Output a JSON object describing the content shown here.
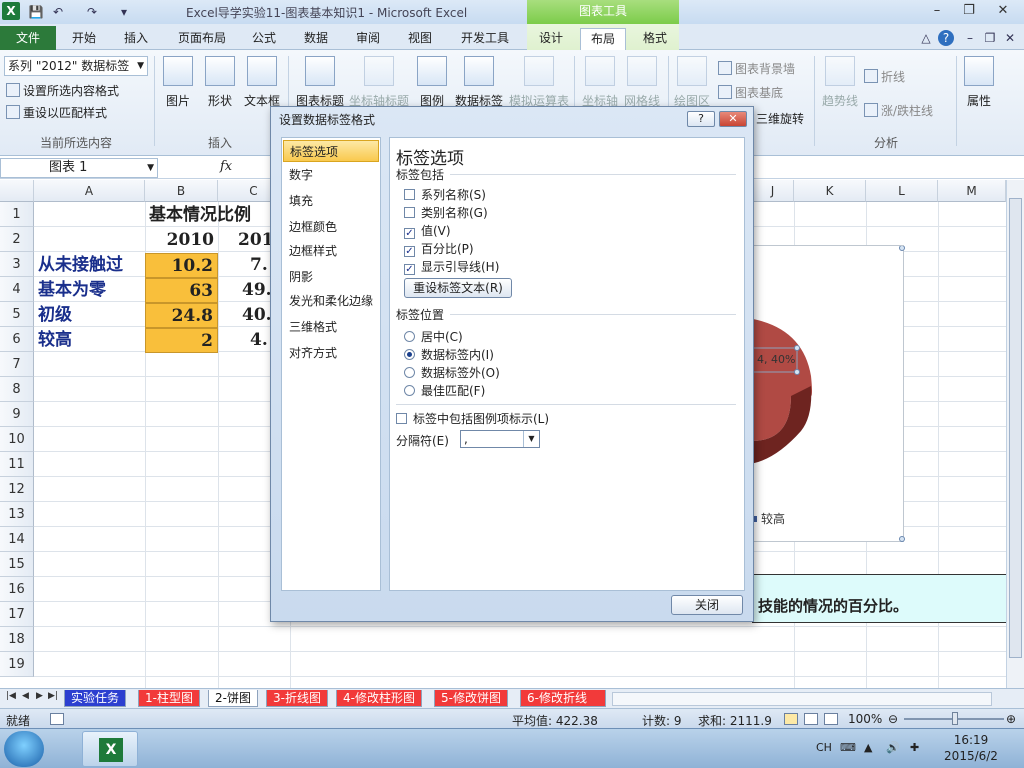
{
  "window": {
    "title": "Excel导学实验11-图表基本知识1 - Microsoft Excel",
    "chart_tools": "图表工具",
    "min": "–",
    "max": "❐",
    "close": "✕"
  },
  "qat": {
    "save": "💾",
    "undo": "↶",
    "redo": "↷",
    "customize": "▾"
  },
  "tabs": [
    "文件",
    "开始",
    "插入",
    "页面布局",
    "公式",
    "数据",
    "审阅",
    "视图",
    "开发工具",
    "设计",
    "布局",
    "格式"
  ],
  "tab_right": {
    "collapse": "△",
    "help": "?",
    "min": "–",
    "restore": "❐",
    "close": "✕"
  },
  "ribbon": {
    "selection_combo": "系列 \"2012\" 数据标签",
    "format_selection": "设置所选内容格式",
    "reset_match": "重设以匹配样式",
    "group_current": "当前所选内容",
    "picture": "图片",
    "shapes": "形状",
    "textbox": "文本框",
    "group_insert": "插入",
    "chart_title": "图表标题",
    "axis_title": "坐标轴标题",
    "legend": "图例",
    "data_labels": "数据标签",
    "data_table": "模拟运算表",
    "axes": "坐标轴",
    "gridlines": "网格线",
    "plot_area": "绘图区",
    "chart_wall": "图表背景墙",
    "chart_floor": "图表基底",
    "rotation_3d": "三维旋转",
    "trendline": "趋势线",
    "lines": "折线",
    "updown_bars": "涨/跌柱线",
    "group_analysis": "分析",
    "properties": "属性"
  },
  "formula": {
    "name_box": "图表 1",
    "fx": "fx"
  },
  "columns": [
    "A",
    "B",
    "C",
    "J",
    "K",
    "L",
    "M"
  ],
  "rows": [
    "1",
    "2",
    "3",
    "4",
    "5",
    "6",
    "7",
    "8",
    "9",
    "10",
    "11",
    "12",
    "13",
    "14",
    "15",
    "16",
    "17",
    "18",
    "19"
  ],
  "sheet": {
    "title": "基本情况比例",
    "header_b": "2010",
    "header_c": "201",
    "r3": {
      "label": "从未接触过",
      "b": "10.2",
      "c": "7."
    },
    "r4": {
      "label": "基本为零",
      "b": "63",
      "c": "49."
    },
    "r5": {
      "label": "初级",
      "b": "24.8",
      "c": "40."
    },
    "r6": {
      "label": "较高",
      "b": "2",
      "c": "4."
    }
  },
  "chart": {
    "data_label": "4, 40%",
    "legend_entry": "较高",
    "title_fragment": "\\"
  },
  "textbox": "技能的情况的百分比。",
  "dialog": {
    "title": "设置数据标签格式",
    "help": "?",
    "close": "✕",
    "nav": [
      "标签选项",
      "数字",
      "填充",
      "边框颜色",
      "边框样式",
      "阴影",
      "发光和柔化边缘",
      "三维格式",
      "对齐方式"
    ],
    "panel_title": "标签选项",
    "contains_label": "标签包括",
    "opt_series_name": "系列名称(S)",
    "opt_category_name": "类别名称(G)",
    "opt_value": "值(V)",
    "opt_percent": "百分比(P)",
    "opt_leader": "显示引导线(H)",
    "reset_text_button": "重设标签文本(R)",
    "position_label": "标签位置",
    "pos_center": "居中(C)",
    "pos_inside_end": "数据标签内(I)",
    "pos_outside_end": "数据标签外(O)",
    "pos_best_fit": "最佳匹配(F)",
    "legend_key": "标签中包括图例项标示(L)",
    "separator_label": "分隔符(E)",
    "separator_value": ",",
    "close_button": "关闭",
    "checks": {
      "series_name": false,
      "category_name": false,
      "value": true,
      "percent": true,
      "leader": true,
      "legend_key": false
    },
    "position_selected": "inside_end"
  },
  "sheet_tabs": [
    "实验任务",
    "1-柱型图",
    "2-饼图",
    "3-折线图",
    "4-修改柱形图",
    "5-修改饼图",
    "6-修改折线"
  ],
  "status": {
    "ready": "就绪",
    "average": "平均值: 422.38",
    "count": "计数: 9",
    "sum": "求和: 2111.9",
    "zoom": "100%"
  },
  "taskbar": {
    "ime": "CH",
    "time": "16:19",
    "date": "2015/6/2"
  },
  "colors": {
    "excel_green": "#1e7a3a",
    "cell_orange": "#f9bf3b",
    "pie_red": "#b04a44"
  }
}
